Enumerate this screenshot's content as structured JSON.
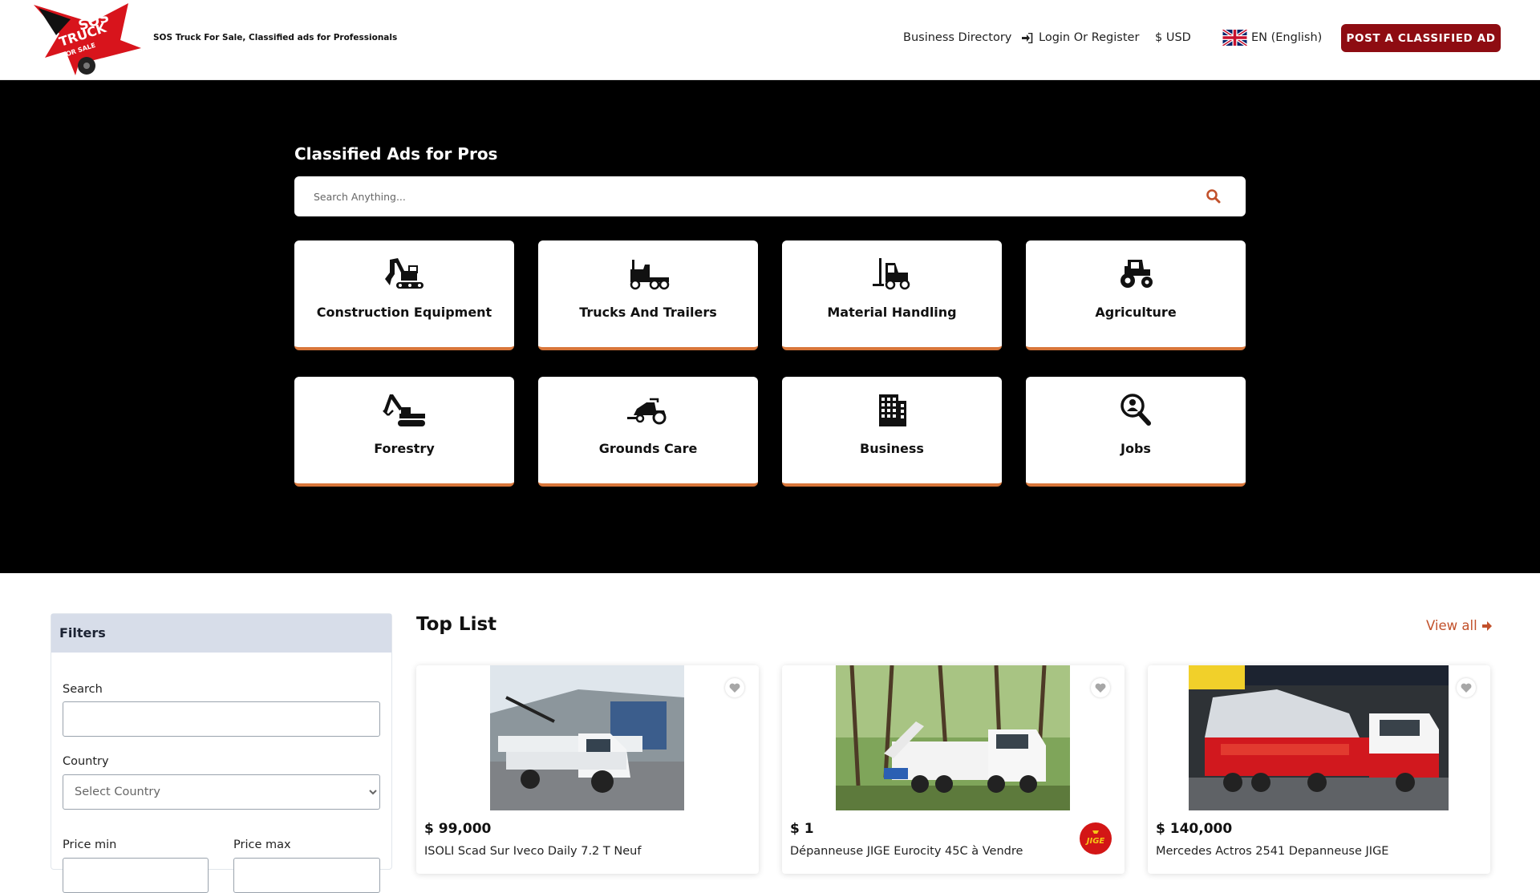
{
  "header": {
    "tagline": "SOS Truck For Sale, Classified ads for Professionals",
    "nav": {
      "business_directory": "Business Directory",
      "login": "Login Or Register",
      "currency": "$ USD",
      "language": "EN (English)"
    },
    "post_button": "POST A CLASSIFIED AD"
  },
  "hero": {
    "title": "Classified Ads for Pros",
    "search_placeholder": "Search Anything...",
    "categories": [
      {
        "label": "Construction Equipment",
        "icon": "excavator-icon"
      },
      {
        "label": "Trucks And Trailers",
        "icon": "truck-icon"
      },
      {
        "label": "Material Handling",
        "icon": "forklift-icon"
      },
      {
        "label": "Agriculture",
        "icon": "tractor-icon"
      },
      {
        "label": "Forestry",
        "icon": "forestry-machine-icon"
      },
      {
        "label": "Grounds Care",
        "icon": "lawn-mower-icon"
      },
      {
        "label": "Business",
        "icon": "building-icon"
      },
      {
        "label": "Jobs",
        "icon": "job-search-icon"
      }
    ]
  },
  "filters": {
    "title": "Filters",
    "search_label": "Search",
    "country_label": "Country",
    "country_placeholder": "Select Country",
    "price_min_label": "Price min",
    "price_max_label": "Price max"
  },
  "toplist": {
    "title": "Top List",
    "view_all": "View all",
    "listings": [
      {
        "price": "$ 99,000",
        "title": "ISOLI Scad Sur Iveco Daily 7.2 T Neuf"
      },
      {
        "price": "$ 1",
        "title": "Dépanneuse JIGE Eurocity 45C à Vendre",
        "badge": "JIGE"
      },
      {
        "price": "$ 140,000",
        "title": "Mercedes Actros 2541 Depanneuse JIGE"
      }
    ]
  },
  "colors": {
    "accent": "#8e0c12",
    "card_border": "#d8763a",
    "link": "#c2512b",
    "filters_header": "#d7dde9"
  }
}
